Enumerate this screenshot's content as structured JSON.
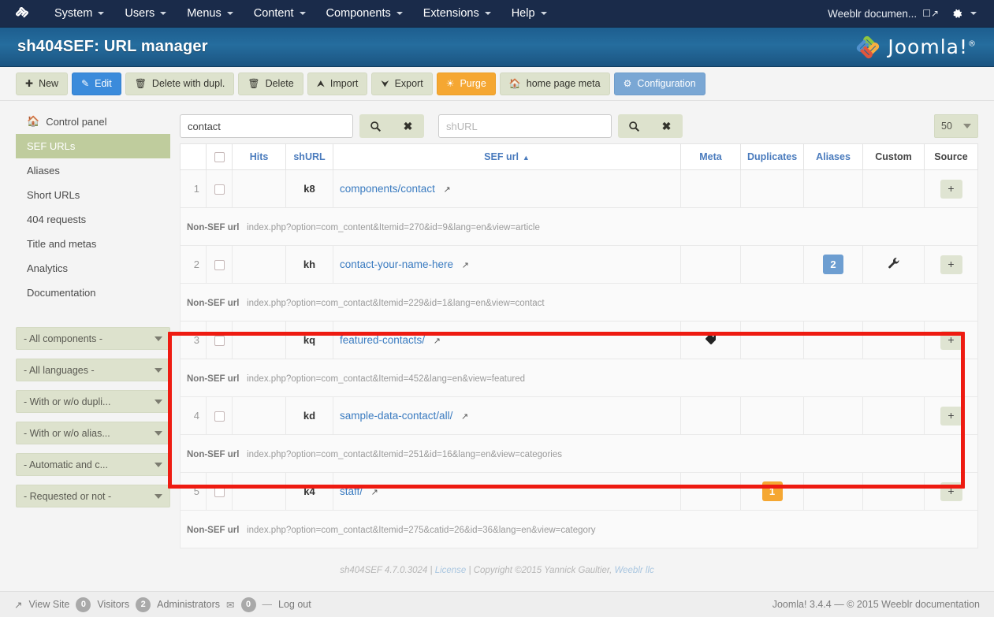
{
  "topbar": {
    "logo_icon": "joomla-logo-icon",
    "menu": [
      {
        "label": "System",
        "caret": true
      },
      {
        "label": "Users",
        "caret": true
      },
      {
        "label": "Menus",
        "caret": true
      },
      {
        "label": "Content",
        "caret": true
      },
      {
        "label": "Components",
        "caret": true
      },
      {
        "label": "Extensions",
        "caret": true
      },
      {
        "label": "Help",
        "caret": true
      }
    ],
    "user_label": "Weeblr documen...",
    "user_ext_icon": "external-link-icon",
    "gear_icon": "gear-icon"
  },
  "header": {
    "title": "sh404SEF: URL manager",
    "logo_text": "Joomla!",
    "logo_sup": "®"
  },
  "toolbar": [
    {
      "label": "New",
      "icon": "plus-circle-icon",
      "style": "default"
    },
    {
      "label": "Edit",
      "icon": "pencil-square-icon",
      "style": "blue"
    },
    {
      "label": "Delete with dupl.",
      "icon": "trash-icon",
      "style": "default"
    },
    {
      "label": "Delete",
      "icon": "trash-icon",
      "style": "default"
    },
    {
      "label": "Import",
      "icon": "upload-icon",
      "style": "default"
    },
    {
      "label": "Export",
      "icon": "download-icon",
      "style": "default"
    },
    {
      "label": "Purge",
      "icon": "purge-icon",
      "style": "orange"
    },
    {
      "label": "home page meta",
      "icon": "home-icon",
      "style": "default"
    },
    {
      "label": "Configuration",
      "icon": "gear-icon",
      "style": "blue-soft"
    }
  ],
  "sidebar": {
    "items": [
      {
        "label": "Control panel",
        "icon": "home-icon",
        "active": false
      },
      {
        "label": "SEF URLs",
        "icon": "",
        "active": true
      },
      {
        "label": "Aliases",
        "icon": "",
        "active": false
      },
      {
        "label": "Short URLs",
        "icon": "",
        "active": false
      },
      {
        "label": "404 requests",
        "icon": "",
        "active": false
      },
      {
        "label": "Title and metas",
        "icon": "",
        "active": false
      },
      {
        "label": "Analytics",
        "icon": "",
        "active": false
      },
      {
        "label": "Documentation",
        "icon": "",
        "active": false
      }
    ],
    "filters": [
      {
        "label": "- All components -"
      },
      {
        "label": "- All languages -"
      },
      {
        "label": "- With or w/o dupli..."
      },
      {
        "label": "- With or w/o alias..."
      },
      {
        "label": "- Automatic and c..."
      },
      {
        "label": "- Requested or not -"
      }
    ]
  },
  "search": {
    "sef_value": "contact",
    "sef_placeholder": "",
    "shurl_value": "",
    "shurl_placeholder": "shURL",
    "search_icon": "magnifier-icon",
    "clear_icon": "clear-x-icon",
    "limit_value": "50"
  },
  "table": {
    "headers": {
      "num": "",
      "check": "",
      "hits": "Hits",
      "shurl": "shURL",
      "sef": "SEF url",
      "sort_arrow": "▲",
      "meta": "Meta",
      "duplicates": "Duplicates",
      "aliases": "Aliases",
      "custom": "Custom",
      "source": "Source"
    },
    "nonsef_label": "Non-SEF url",
    "rows": [
      {
        "num": "1",
        "hits": "",
        "shurl": "k8",
        "sef": "components/contact",
        "meta": "",
        "duplicates": "",
        "aliases": "",
        "custom": "",
        "source": "+",
        "nonsef": "index.php?option=com_content&Itemid=270&id=9&lang=en&view=article",
        "highlight": false
      },
      {
        "num": "2",
        "hits": "",
        "shurl": "kh",
        "sef": "contact-your-name-here",
        "meta": "",
        "duplicates": "",
        "aliases": "2",
        "aliases_style": "blue",
        "custom": "wrench-icon",
        "source": "+",
        "nonsef": "index.php?option=com_contact&Itemid=229&id=1&lang=en&view=contact",
        "highlight": false
      },
      {
        "num": "3",
        "hits": "",
        "shurl": "kq",
        "sef": "featured-contacts/",
        "meta": "tag-icon",
        "duplicates": "",
        "aliases": "",
        "custom": "",
        "source": "+",
        "nonsef": "index.php?option=com_contact&Itemid=452&lang=en&view=featured",
        "highlight": true
      },
      {
        "num": "4",
        "hits": "",
        "shurl": "kd",
        "sef": "sample-data-contact/all/",
        "meta": "",
        "duplicates": "",
        "aliases": "",
        "custom": "",
        "source": "+",
        "nonsef": "index.php?option=com_contact&Itemid=251&id=16&lang=en&view=categories",
        "highlight": true
      },
      {
        "num": "5",
        "hits": "",
        "shurl": "k4",
        "sef": "staff/",
        "meta": "",
        "duplicates": "1",
        "duplicates_style": "orange",
        "aliases": "",
        "custom": "",
        "source": "+",
        "nonsef": "index.php?option=com_contact&Itemid=275&catid=26&id=36&lang=en&view=category",
        "highlight": false
      }
    ]
  },
  "copyright": {
    "version": "sh404SEF 4.7.0.3024",
    "sep1": "|",
    "license": "License",
    "sep2": "|",
    "text": "Copyright ©2015 Yannick Gaultier,",
    "company": "Weeblr llc"
  },
  "statusbar": {
    "view_site": "View Site",
    "view_site_icon": "external-link-icon",
    "visitors_count": "0",
    "visitors_label": "Visitors",
    "admins_count": "2",
    "admins_label": "Administrators",
    "mail_icon": "envelope-icon",
    "messages_count": "0",
    "logout_label": "Log out",
    "right_text": "Joomla! 3.4.4  —  © 2015 Weeblr documentation"
  },
  "colors": {
    "accent_blue": "#3b8bdb",
    "header_blue": "#256d9e",
    "topbar_navy": "#1a2b4a",
    "sidebar_active": "#bfcc9d",
    "button_sage": "#dde2cd",
    "orange": "#f5a732",
    "highlight_red": "#ee1b11",
    "link_blue": "#3a7bc0"
  }
}
